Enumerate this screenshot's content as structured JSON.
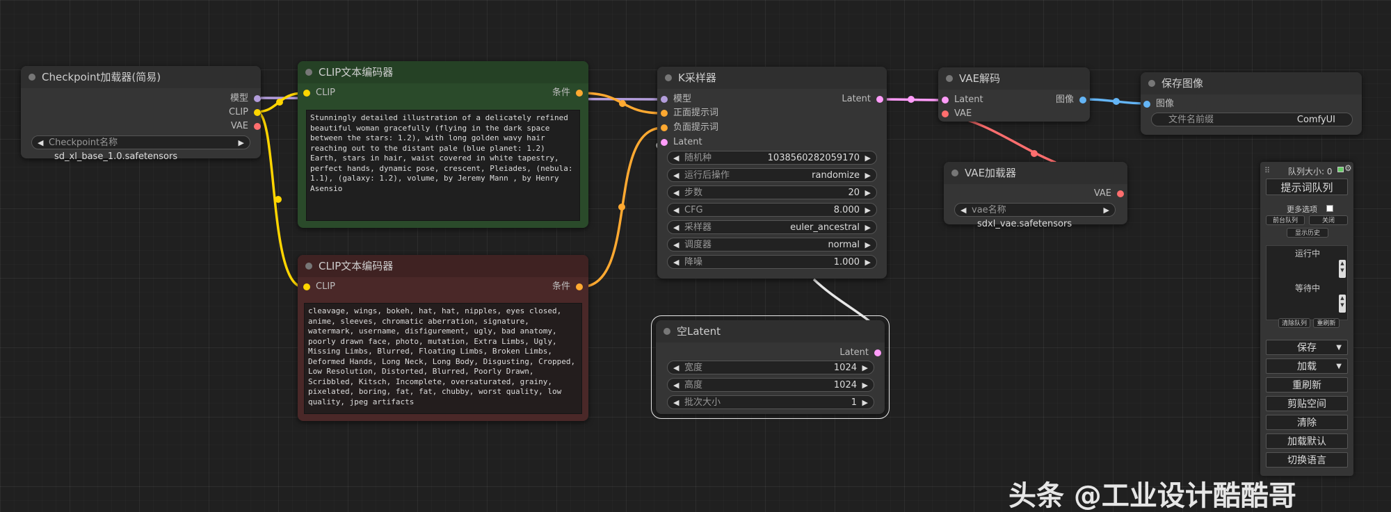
{
  "colors": {
    "model": "#b39ddb",
    "clip": "#ffd500",
    "vae": "#ff6e6e",
    "conditioning": "#ffa931",
    "latent": "#ff9cf9",
    "image": "#64b5f6"
  },
  "nodes": {
    "checkpoint": {
      "title": "Checkpoint加载器(简易)",
      "out_model": "模型",
      "out_clip": "CLIP",
      "out_vae": "VAE",
      "w_label": "Checkpoint名称",
      "w_value": "sd_xl_base_1.0.safetensors"
    },
    "clip_pos": {
      "title": "CLIP文本编码器",
      "in_clip": "CLIP",
      "out_cond": "条件",
      "text": "Stunningly detailed illustration of a delicately refined beautiful woman gracefully (flying in the dark space between the stars: 1.2), with long golden wavy hair reaching out to the distant pale (blue planet: 1.2) Earth, stars in hair, waist covered in white tapestry, perfect hands, dynamic pose, crescent, Pleiades, (nebula: 1.1), (galaxy: 1.2), volume, by Jeremy Mann , by Henry Asensio"
    },
    "clip_neg": {
      "title": "CLIP文本编码器",
      "in_clip": "CLIP",
      "out_cond": "条件",
      "text": "cleavage, wings, bokeh, hat, hat, nipples, eyes closed, anime, sleeves, chromatic aberration, signature, watermark, username, disfigurement, ugly, bad anatomy, poorly drawn face, photo, mutation, Extra Limbs, Ugly, Missing Limbs, Blurred, Floating Limbs, Broken Limbs, Deformed Hands, Long Neck, Long Body, Disgusting, Cropped, Low Resolution, Distorted, Blurred, Poorly Drawn, Scribbled, Kitsch, Incomplete, oversaturated, grainy, pixelated, boring, fat, fat, chubby, worst quality, low quality, jpeg artifacts"
    },
    "ksampler": {
      "title": "K采样器",
      "in_model": "模型",
      "in_pos": "正面提示词",
      "in_neg": "负面提示词",
      "in_latent": "Latent",
      "out_latent": "Latent",
      "widgets": [
        {
          "label": "随机种",
          "value": "1038560282059170"
        },
        {
          "label": "运行后操作",
          "value": "randomize"
        },
        {
          "label": "步数",
          "value": "20"
        },
        {
          "label": "CFG",
          "value": "8.000"
        },
        {
          "label": "采样器",
          "value": "euler_ancestral"
        },
        {
          "label": "调度器",
          "value": "normal"
        },
        {
          "label": "降噪",
          "value": "1.000"
        }
      ]
    },
    "vae_decode": {
      "title": "VAE解码",
      "in_latent": "Latent",
      "in_vae": "VAE",
      "out_image": "图像"
    },
    "save_image": {
      "title": "保存图像",
      "in_image": "图像",
      "w_label": "文件名前缀",
      "w_value": "ComfyUI"
    },
    "vae_loader": {
      "title": "VAE加载器",
      "out_vae": "VAE",
      "w_label": "vae名称",
      "w_value": "sdxl_vae.safetensors"
    },
    "empty_latent": {
      "title": "空Latent",
      "out_latent": "Latent",
      "widgets": [
        {
          "label": "宽度",
          "value": "1024"
        },
        {
          "label": "高度",
          "value": "1024"
        },
        {
          "label": "批次大小",
          "value": "1"
        }
      ]
    }
  },
  "panel": {
    "queue_size": "队列大小: 0",
    "queue_prompt": "提示词队列",
    "more_options": "更多选项",
    "front_queue": "前台队列",
    "close": "关闭",
    "show_history": "显示历史",
    "running": "运行中",
    "pending": "等待中",
    "clear_queue": "清除队列",
    "refresh_small": "重刷新",
    "save": "保存",
    "load": "加载",
    "refresh": "重刷新",
    "clipspace": "剪贴空间",
    "clear": "清除",
    "load_default": "加载默认",
    "switch_language": "切换语言"
  },
  "watermark": "头条 @工业设计酷酷哥"
}
